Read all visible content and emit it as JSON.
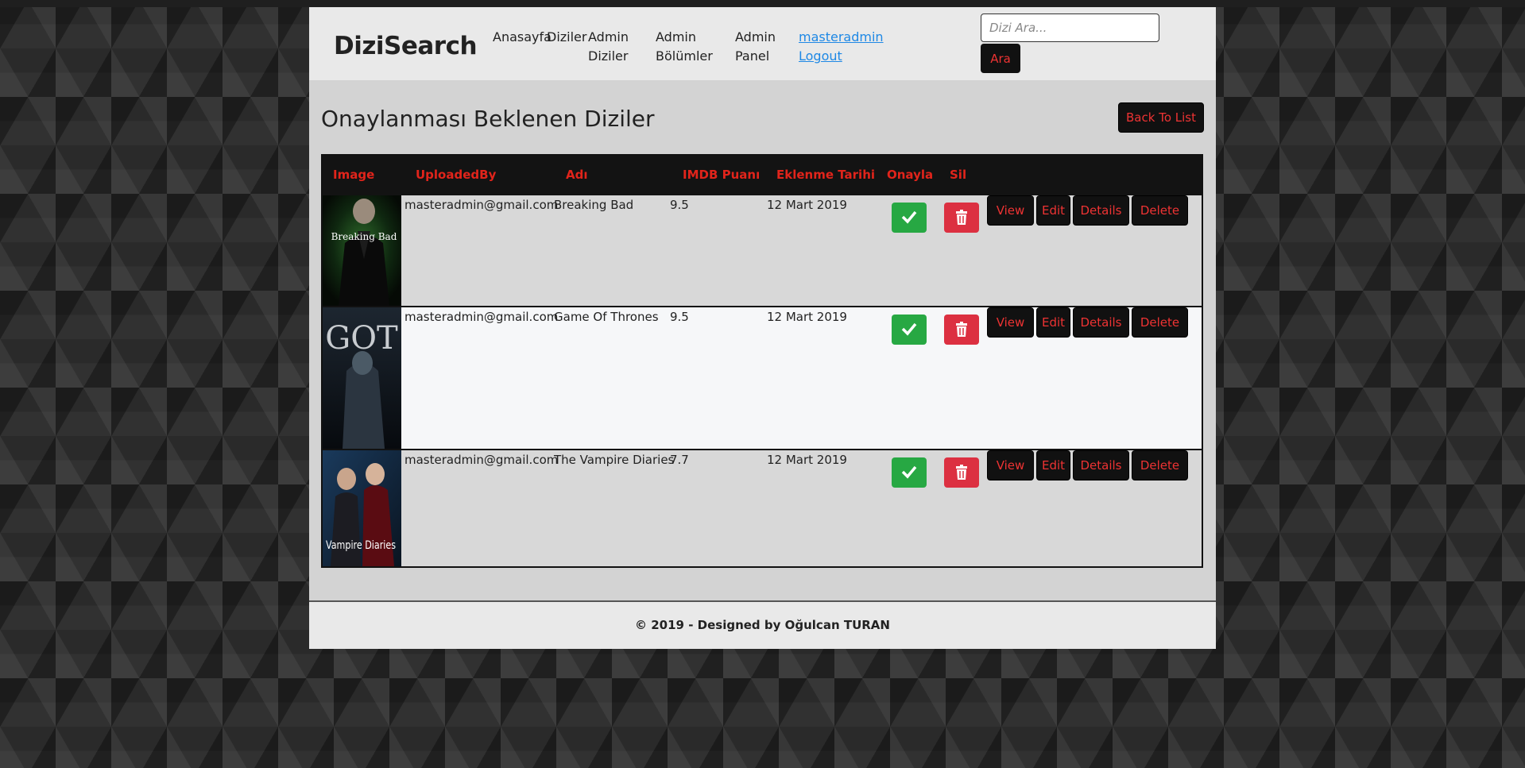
{
  "brand": "DiziSearch",
  "nav": {
    "home": "Anasayfa",
    "series": "Diziler",
    "admin_series_1": "Admin",
    "admin_series_2": "Diziler",
    "admin_episodes_1": "Admin",
    "admin_episodes_2": "Bölümler",
    "admin_panel_1": "Admin",
    "admin_panel_2": "Panel",
    "username": "masteradmin",
    "logout": "Logout"
  },
  "search": {
    "placeholder": "Dizi Ara...",
    "button": "Ara"
  },
  "page": {
    "title": "Onaylanması Beklenen Diziler",
    "back_button": "Back To List"
  },
  "table": {
    "headers": [
      "Image",
      "UploadedBy",
      "Adı",
      "IMDB Puanı",
      "Eklenme Tarihi",
      "Onayla",
      "Sil"
    ],
    "rows": [
      {
        "poster_text": "Breaking Bad",
        "uploaded_by": "masteradmin@gmail.com",
        "name": "Breaking Bad",
        "imdb": "9.5",
        "date": "12 Mart 2019"
      },
      {
        "poster_text": "GOT",
        "uploaded_by": "masteradmin@gmail.com",
        "name": "Game Of Thrones",
        "imdb": "9.5",
        "date": "12 Mart 2019"
      },
      {
        "poster_text": "Vampire Diaries",
        "uploaded_by": "masteradmin@gmail.com",
        "name": "The Vampire Diaries",
        "imdb": "7.7",
        "date": "12 Mart 2019"
      }
    ],
    "actions": {
      "view": "View",
      "edit": "Edit",
      "details": "Details",
      "delete": "Delete"
    }
  },
  "footer": {
    "text": "© 2019 - Designed by Oğulcan TURAN"
  },
  "colors": {
    "accent_red": "#e1241b",
    "approve_green": "#27a843",
    "delete_red": "#dc3041",
    "link_blue": "#1e88e5"
  },
  "icons": {
    "approve": "check-icon",
    "delete": "trash-icon"
  }
}
